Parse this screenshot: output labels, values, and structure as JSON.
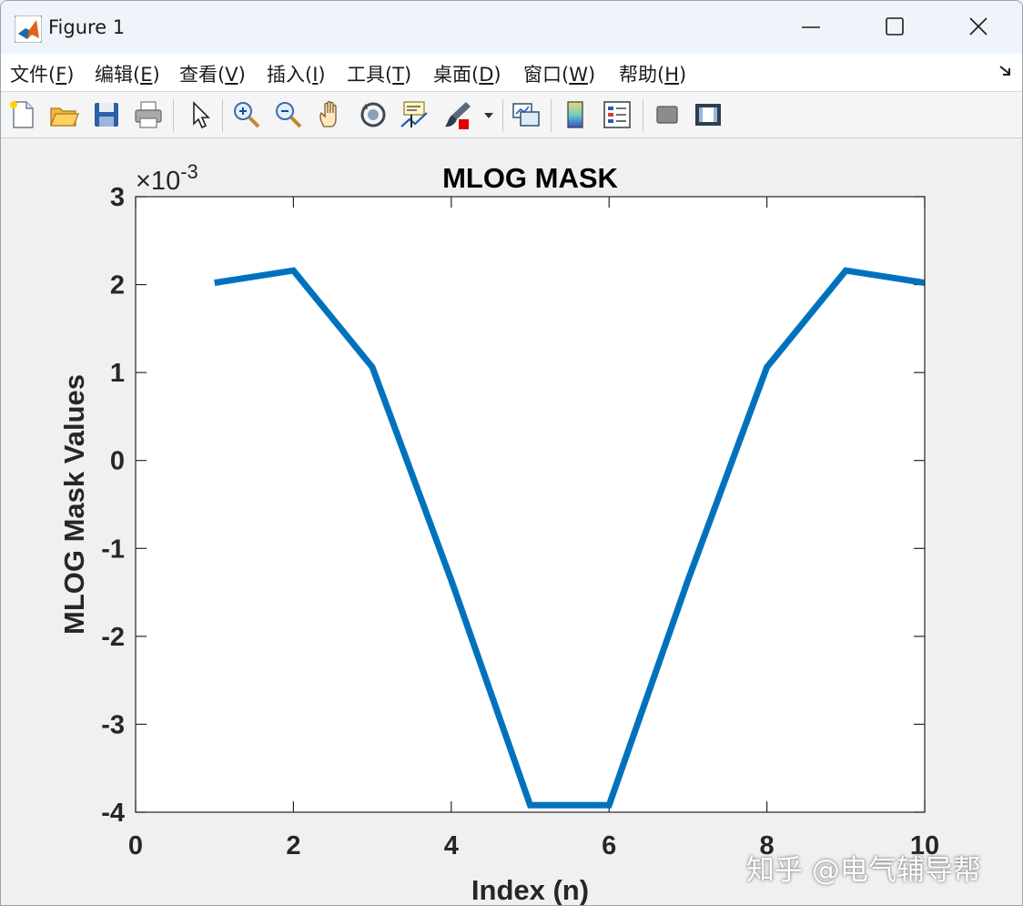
{
  "window": {
    "title": "Figure 1"
  },
  "menu": {
    "items": [
      {
        "label": "文件(",
        "key": "F",
        "suffix": ")"
      },
      {
        "label": "编辑(",
        "key": "E",
        "suffix": ")"
      },
      {
        "label": "查看(",
        "key": "V",
        "suffix": ")"
      },
      {
        "label": "插入(",
        "key": "I",
        "suffix": ")"
      },
      {
        "label": "工具(",
        "key": "T",
        "suffix": ")"
      },
      {
        "label": "桌面(",
        "key": "D",
        "suffix": ")"
      },
      {
        "label": "窗口(",
        "key": "W",
        "suffix": ")"
      },
      {
        "label": "帮助(",
        "key": "H",
        "suffix": ")"
      }
    ]
  },
  "toolbar": {
    "icons": [
      "new-figure-icon",
      "open-file-icon",
      "save-icon",
      "print-icon",
      "edit-plot-arrow-icon",
      "zoom-in-icon",
      "zoom-out-icon",
      "pan-hand-icon",
      "rotate-3d-icon",
      "data-cursor-icon",
      "brush-icon",
      "brush-dropdown-icon",
      "link-plot-icon",
      "colorbar-icon",
      "legend-icon",
      "hide-plot-tools-icon",
      "show-plot-tools-icon"
    ]
  },
  "colors": {
    "line": "#0072bd",
    "axes_bg": "#ffffff",
    "figure_bg": "#f0f0f0",
    "text": "#262626"
  },
  "chart_data": {
    "type": "line",
    "title": "MLOG MASK",
    "xlabel": "Index (n)",
    "ylabel": "MLOG Mask Values",
    "exponent_label": "×10",
    "exponent_power": "-3",
    "xlim": [
      0,
      10
    ],
    "ylim": [
      -4,
      3
    ],
    "xticks": [
      0,
      2,
      4,
      6,
      8,
      10
    ],
    "yticks": [
      -4,
      -3,
      -2,
      -1,
      0,
      1,
      2,
      3
    ],
    "grid": false,
    "series": [
      {
        "x": [
          1,
          2,
          3,
          4,
          5,
          6,
          7,
          8,
          9,
          10
        ],
        "y": [
          2.02,
          2.16,
          1.06,
          -1.36,
          -3.92,
          -3.92,
          -1.36,
          1.06,
          2.16,
          2.02
        ],
        "y_multiplier": 0.001
      }
    ]
  },
  "watermark": "知乎 @电气辅导帮"
}
